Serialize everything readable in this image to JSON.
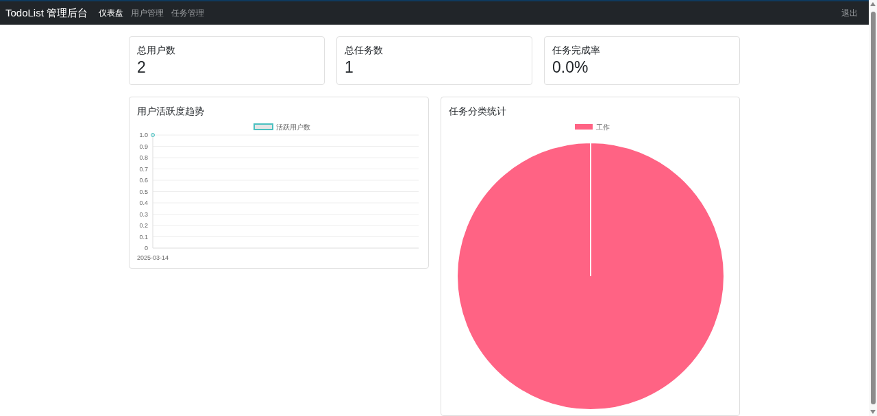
{
  "navbar": {
    "brand": "TodoList 管理后台",
    "items": [
      {
        "label": "仪表盘",
        "selected": true
      },
      {
        "label": "用户管理",
        "selected": false
      },
      {
        "label": "任务管理",
        "selected": false
      }
    ],
    "logout": "退出"
  },
  "stats": [
    {
      "label": "总用户数",
      "value": "2"
    },
    {
      "label": "总任务数",
      "value": "1"
    },
    {
      "label": "任务完成率",
      "value": "0.0%"
    }
  ],
  "charts": [
    {
      "title": "用户活跃度趋势",
      "chart_data": {
        "type": "line",
        "categories": [
          "2025-03-14"
        ],
        "series": [
          {
            "name": "活跃用户数",
            "color": "#4bc0c0",
            "values": [
              1
            ],
            "marker": true
          }
        ],
        "grid": true,
        "ylim": [
          0,
          1
        ],
        "yticks": [
          0,
          0.1,
          0.2,
          0.3,
          0.4,
          0.5,
          0.6,
          0.7,
          0.8,
          0.9,
          {
            "value": 1,
            "label": "1.0"
          }
        ]
      }
    },
    {
      "title": "任务分类统计",
      "chart_data": {
        "type": "pie",
        "categories": [
          "工作"
        ],
        "series": [
          {
            "color": "#ff6384",
            "values": [
              1
            ]
          }
        ]
      }
    }
  ]
}
